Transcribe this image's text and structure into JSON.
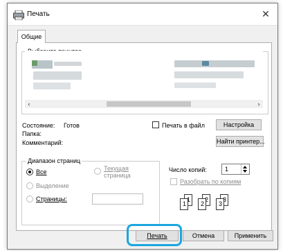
{
  "window": {
    "title": "Печать",
    "close_glyph": "✕",
    "icon": "printer-icon"
  },
  "tabs": [
    {
      "label": "Общие",
      "selected": true
    }
  ],
  "printer_group": {
    "legend": "Выберите принтер"
  },
  "printer_scroll": {
    "left_arrow": "‹",
    "right_arrow": "›"
  },
  "status": {
    "state_label": "Состояние:",
    "state_value": "Готов",
    "folder_label": "Папка:",
    "comment_label": "Комментарий:"
  },
  "print_to_file": {
    "label": "Печать в файл",
    "checked": false
  },
  "buttons": {
    "settings": "Настройка",
    "find_printer": "Найти принтер...",
    "print": "Печать",
    "cancel": "Отмена",
    "apply": "Применить"
  },
  "page_range": {
    "legend": "Диапазон страниц",
    "options": [
      {
        "label": "Все",
        "checked": true,
        "enabled": true
      },
      {
        "label": "Текущая страница",
        "checked": false,
        "enabled": false
      },
      {
        "label": "Выделение",
        "checked": false,
        "enabled": false
      },
      {
        "label": "Страницы:",
        "checked": false,
        "enabled": true
      }
    ],
    "current_page_line1": "Текущая",
    "current_page_line2": "страница",
    "pages_value": ""
  },
  "copies": {
    "label": "Число копий:",
    "value": "1",
    "collate_label": "Разобрать по копиям",
    "collate_checked": false
  },
  "collate_icons": [
    {
      "back": "1",
      "front": "1"
    },
    {
      "back": "2",
      "front": "2"
    },
    {
      "back": "3",
      "front": "3"
    }
  ],
  "colors": {
    "highlight": "#1aa6e0",
    "dialog_bg": "#f0f0f0",
    "button_bg": "#e1e1e1"
  }
}
